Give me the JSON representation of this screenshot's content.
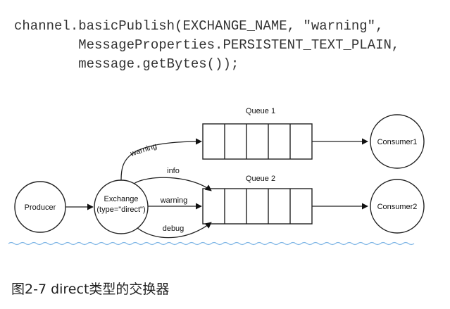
{
  "code": {
    "line1": "channel.basicPublish(EXCHANGE_NAME, \"warning\",",
    "line2": "        MessageProperties.PERSISTENT_TEXT_PLAIN,",
    "line3": "        message.getBytes());"
  },
  "diagram": {
    "producer": "Producer",
    "exchange_line1": "Exchange",
    "exchange_line2": "(type=\"direct\")",
    "queue1_label": "Queue 1",
    "queue2_label": "Queue 2",
    "consumer1": "Consumer1",
    "consumer2": "Consumer2",
    "route_q1": "warning",
    "route_info": "info",
    "route_warning": "warning",
    "route_debug": "debug"
  },
  "caption": "图2-7 direct类型的交换器"
}
